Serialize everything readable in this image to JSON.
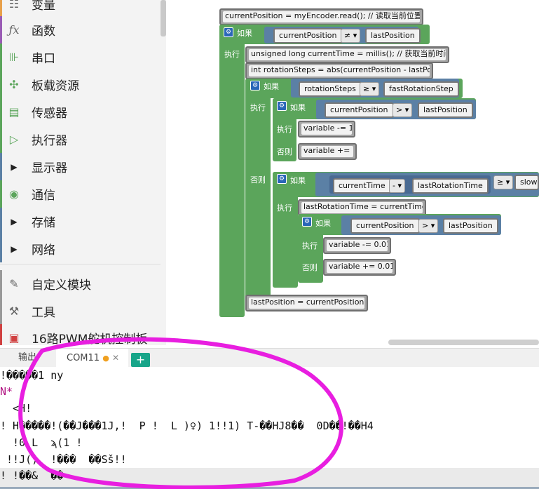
{
  "sidebar": {
    "categories": [
      {
        "label": "变量",
        "icon": "variable-icon",
        "color": "#e8a04a"
      },
      {
        "label": "函数",
        "icon": "function-icon",
        "color": "#9a5bb5"
      },
      {
        "label": "串口",
        "icon": "serial-icon",
        "color": "#5ba55b"
      },
      {
        "label": "板载资源",
        "icon": "board-icon",
        "color": "#5ba55b"
      },
      {
        "label": "传感器",
        "icon": "sensor-icon",
        "color": "#5ba55b"
      },
      {
        "label": "执行器",
        "icon": "actuator-icon",
        "color": "#5ba55b"
      },
      {
        "label": "显示器",
        "icon": "expand-arrow-icon",
        "color": "#5b80a5"
      },
      {
        "label": "通信",
        "icon": "communication-icon",
        "color": "#5ba55b"
      },
      {
        "label": "存储",
        "icon": "expand-arrow-icon",
        "color": "#5b80a5"
      },
      {
        "label": "网络",
        "icon": "expand-arrow-icon",
        "color": "#5b80a5"
      },
      {
        "label": "自定义模块",
        "icon": "custom-module-icon",
        "color": "#888888"
      },
      {
        "label": "工具",
        "icon": "tools-icon",
        "color": "#888888"
      },
      {
        "label": "16路PWM舵机控制板",
        "icon": "pwm-board-icon",
        "color": "#d04040"
      }
    ]
  },
  "blocks": {
    "read": "currentPosition = myEncoder.read();  // 读取当前位置",
    "if": "如果",
    "do": "执行",
    "else": "否则",
    "cur_pos": "currentPosition",
    "last_pos": "lastPosition",
    "neq": "≠ ▾",
    "millis": "unsigned long currentTime = millis(); // 获取当前时间",
    "steps": "int rotationSteps = abs(currentPosition - lastPo...",
    "rot_steps": "rotationSteps",
    "gte": "≥ ▾",
    "fast": "fastRotationStep",
    "gt": "> ▾",
    "dec1": "variable -= 1;",
    "inc1": "variable += 1;",
    "cur_time": "currentTime",
    "minus": "- ▾",
    "last_rot": "lastRotationTime",
    "gte2": "≥ ▾",
    "slow": "slow",
    "assign_rot": "lastRotationTime = currentTime;",
    "dec01": "variable -= 0.01;",
    "inc01": "variable += 0.01;",
    "assign_pos": "lastPosition = currentPosition;"
  },
  "panel": {
    "tab_output": "输出",
    "tab_com": "COM11",
    "plus": "+"
  },
  "console": [
    "!�����1 ny",
    "N*",
    "  <H!",
    "! H�����!(��J���1J,!  P !  L )♀) 1!!1) T-��HJ8��  0D��!��H4",
    "  !0 L  ϡ(1 !",
    " !!J()  !���  ��Sš!!",
    "! !��&  ��="
  ]
}
